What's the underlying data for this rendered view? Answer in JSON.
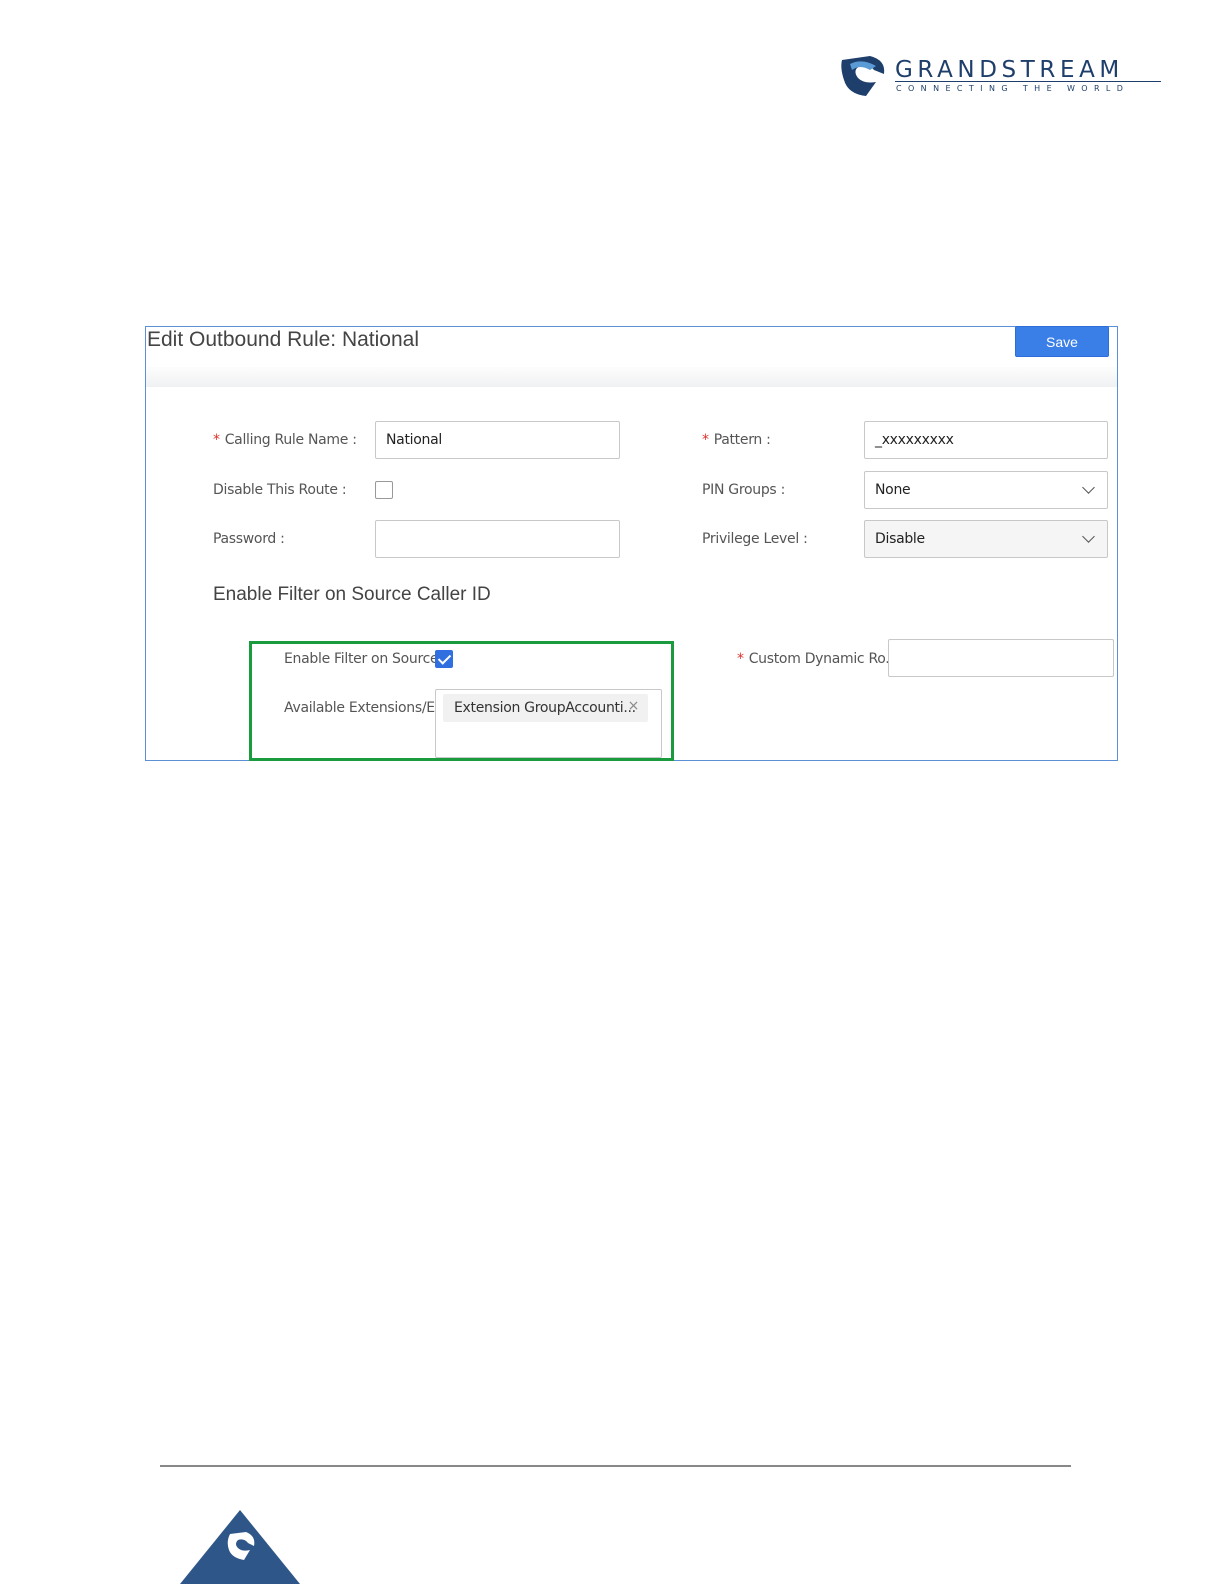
{
  "brand": {
    "name": "GRANDSTREAM",
    "tagline": "CONNECTING THE WORLD",
    "color": "#1e3f6b"
  },
  "dialog": {
    "title": "Edit Outbound Rule: National",
    "save_label": "Save",
    "accent": "#3a7ee8"
  },
  "form": {
    "calling_rule_name": {
      "label": "Calling Rule Name",
      "value": "National",
      "required": true
    },
    "disable_route": {
      "label": "Disable This Route",
      "checked": false
    },
    "password": {
      "label": "Password",
      "value": ""
    },
    "pattern": {
      "label": "Pattern",
      "value": "_xxxxxxxxx",
      "required": true
    },
    "pin_groups": {
      "label": "PIN Groups",
      "value": "None"
    },
    "privilege_level": {
      "label": "Privilege Level",
      "value": "Disable"
    }
  },
  "filter_section": {
    "title": "Enable Filter on Source Caller ID",
    "enable_label": "Enable Filter on Source...",
    "enabled": true,
    "available_label": "Available Extensions/E...",
    "selected_tag": "Extension GroupAccounti...",
    "tag_close": "×",
    "highlight_color": "#1a9c3e",
    "custom_dynamic_route": {
      "label": "Custom Dynamic Ro...",
      "value": "",
      "required": true
    }
  },
  "icons": {
    "required": "*",
    "colon": ":"
  }
}
